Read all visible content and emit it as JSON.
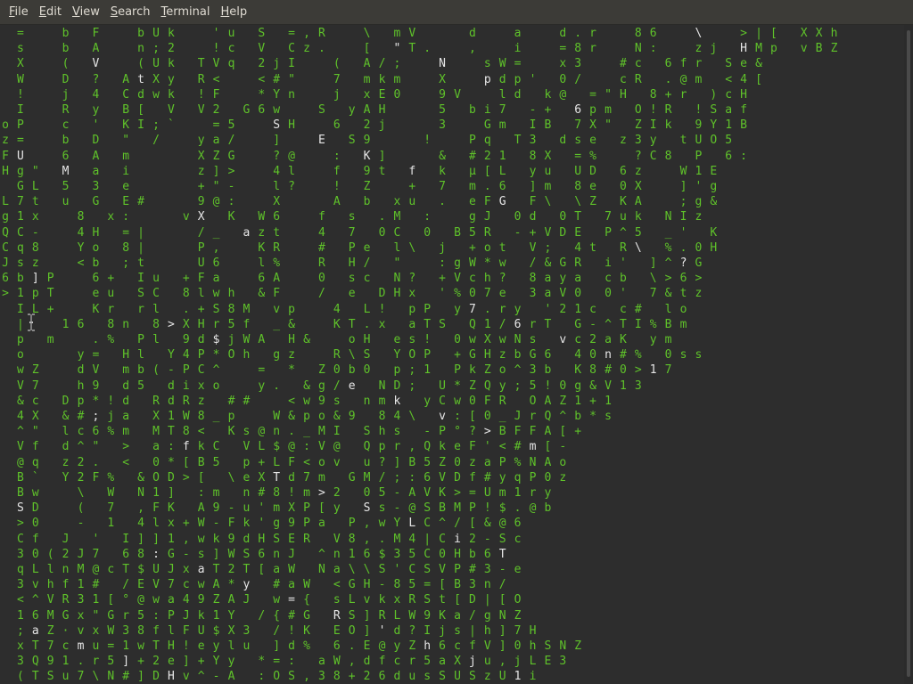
{
  "menu": [
    {
      "mnemonic": "F",
      "rest": "ile"
    },
    {
      "mnemonic": "E",
      "rest": "dit"
    },
    {
      "mnemonic": "V",
      "rest": "iew"
    },
    {
      "mnemonic": "S",
      "rest": "earch"
    },
    {
      "mnemonic": "T",
      "rest": "erminal"
    },
    {
      "mnemonic": "H",
      "rest": "elp"
    }
  ],
  "colors": {
    "background": "#2d2d2d",
    "menubar": "#3c3b37",
    "matrix_green": "#5fc22a",
    "matrix_highlight": "#e6e6e6"
  },
  "cursor_icon": "ibeam-cursor-icon",
  "matrix_rows": [
    "  =     b   F     b U k     ' u   S   = , R     \\   m V       d     a     d . r     8 6     \\     > | [   X X h",
    "  s     b   A     n ; 2     ! c   V   C z .     [   \" T .     ,     i     = 8 r     N :     z j   H M p   v B Z",
    "  X     (   V     ( U k   T V q   2 j I     (   A / ;     N     s W =     x 3     # c   6 f r   S e &",
    "  W     D   ?   A t X y   R <     < # \"     7   m k m     X     p d p '   0 /     c R   . @ m   < 4 [",
    "  !     j   4   C d w k   ! F     * Y n     j   x E 0     9 V     l d   k @   = \" H   8 + r   ) c H",
    "  I     R   y   B [   V   V 2   G 6 w     S   y A H       5   b i 7   - +   6 p m   O ! R   ! S a f",
    "o P     c   '   K I ; `     = 5     S H     6   2 j       3     G m   I B   7 X \"   Z I k   9 Y 1 B",
    "z =     b   D   \"   /     y a /     ]     E   S 9       !     P q   T 3   d s e   z 3 y   t U O 5",
    "F U     6   A   m         X Z G     ? @     :   K ]       &   # 2 1   8 X   = %     ? C 8   P   6 :",
    "H g \"   M   a   i         z ] >     4 l     f   9 t   f   k   µ [ L   y u   U D   6 z     W 1 E",
    "  G L   5   3   e         + \" -     l ?     !   Z     +   7   m . 6   ] m   8 e   0 X     ] ' g",
    "L 7 t   u   G   E #       9 @ :     X       A   b   x u   .   e F G   F \\   \\ Z   K A     ; g &",
    "g 1 x     8   x :       v X   K   W 6     f   s   . M   :     g J   0 d   0 T   7 u k   N I z",
    "Q C -     4 H   = |       / _   a z t     4   7   0 C   0   B 5 R   - + V D E   P ^ 5   _ '   K",
    "C q 8     Y o   8 |       P ,     K R     #   P e   l \\   j   + o t   V ;   4 t   R \\   % . 0 H",
    "J s z     < b   ; t       U 6     l %     R   H /   \"     : g W * w   / & G R   i '   ] ^ ? G",
    "6 b ] P     6 +   I u   + F a     6 A     0   s c   N ?   + V c h ?   8 a y a   c b   \\ > 6 >",
    "> 1 p T     e u   S C   8 l w h   & F     /   e   D H x   ' % 0 7 e   3 a V 0   0 '   7 & t z",
    "  I L +     K r   r l   . + S 8 M   v p     4   L !   p P   y 7 . r y   ' 2 1 c   c #   l o",
    "  |     1 6   8 n   8 > X H r 5 f   _ &     K T . x   a T S   Q 1 / 6 r T   G - ^ T I % B m",
    "  p   m     . %   P l   9 d $ j W A   H &     o H   e s !   0 w X w N s   v c 2 a K   y m",
    "  o       y =   H l   Y 4 P * O h   g z     R \\ S   Y O P   + G H z b G 6   4 0 n # %   0 s s",
    "  w Z     d V   m b ( - P C ^     =   *   Z 0 b 0   p ; 1   P k Z o ^ 3 b   K 8 # 0 > 1 7",
    "  V 7     h 9   d 5   d i x o     y .   & g / e   N D ;   U * Z Q y ; 5 ! 0 g & V 1 3",
    "  & c   D p * ! d   R d R z   # #     < w 9 s   n m k   y C w 0 F R   O A Z 1 + 1",
    "  4 X   & # ; j a   X 1 W 8 _ p     W & p o & 9   8 4 \\   v : [ 0 _ J r Q ^ b * s",
    "  ^ \"   l c 6 % m   M T 8 <   K s @ n . _ M I   S h s   - P ° ? > B F F A [ +",
    "  V f   d ^ \"   >   a : f k C   V L $ @ : V @   Q p r , Q k e F ' < # m [ -",
    "  @ q   z 2 .   <   0 * [ B 5   p + L F < o v   u ? ] B 5 Z 0 z a P % N A o",
    "  B `   Y 2 F %   & O D > [   \\ e X T d 7 m   G M / ; : 6 V D f # y q P 0 z",
    "  B w     \\   W   N 1 ]   : m   n # 8 ! m > 2   0 5 - A V K > = U m 1 r y",
    "  S D     (   7   , F K   A 9 - u ' m X P [ y   S s - @ S B M P ! $ . @ b",
    "  > 0     -   1   4 l x + W - F k ' g 9 P a   P , w Y L C ^ / [ & @ 6",
    "  C f   J   '   I ] ] 1 , w k 9 d H S E R   V 8 , . M 4 | C i 2 - S c",
    "  3 0 ( 2 J 7   6 8 : G - s ] W S 6 n J   ^ n 1 6 $ 3 5 C 0 H b 6 T",
    "  q L l n M @ c T $ U J x a T 2 T [ a W   N a \\ \\ S ' C S V P # 3 - e",
    "  3 v h f 1 #   / E V 7 c w A * y   # a W   < G H - 8 5 = [ B 3 n /",
    "  < ^ V R 3 1 [ ° @ w a 4 9 Z A J   w = {   s L v k x R S t [ D | [ O",
    "  1 6 M G x \" G r 5 : P J k 1 Y   / { # G   R S ] R L W 9 K a / g N Z",
    "  ; a Z · v x W 3 8 f l F U $ X 3   / ! K   E O ] ' d ? I j s | h ] 7 H",
    "  x T 7 c m u = 1 w T H ! e y l u   ] d %   6 . E @ y Z h 6 c f V ] 0 h S N Z",
    "  3 Q 9 1 . r 5 ] + 2 e ] + Y y   * = :   a W , d f c r 5 a X j u , j L E 3",
    "  ( T S u 7 \\ N # ] D H v ^ - A   : O S , 3 8 + 2 6 d u s S U S z U 1 i"
  ]
}
